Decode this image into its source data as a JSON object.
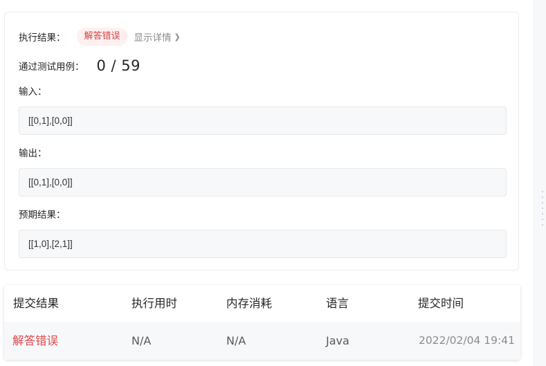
{
  "result": {
    "status_label": "执行结果：",
    "status_badge": "解答错误",
    "detail_link": "显示详情",
    "passed_label": "通过测试用例：",
    "passed_value": "0 / 59",
    "input_label": "输入：",
    "input_value": "[[0,1],[0,0]]",
    "output_label": "输出：",
    "output_value": "[[0,1],[0,0]]",
    "expected_label": "预期结果：",
    "expected_value": "[[1,0],[2,1]]"
  },
  "submissions": {
    "headers": [
      "提交结果",
      "执行用时",
      "内存消耗",
      "语言",
      "提交时间"
    ],
    "rows": [
      {
        "status": "解答错误",
        "runtime": "N/A",
        "memory": "N/A",
        "language": "Java",
        "time": "2022/02/04 19:41"
      }
    ]
  },
  "colors": {
    "error_text": "#dd4b4b",
    "badge_bg": "#fff0f0",
    "code_bg": "#f7f8fa"
  },
  "icons": [
    "chevron-right-icon",
    "drag-handle-icon"
  ]
}
